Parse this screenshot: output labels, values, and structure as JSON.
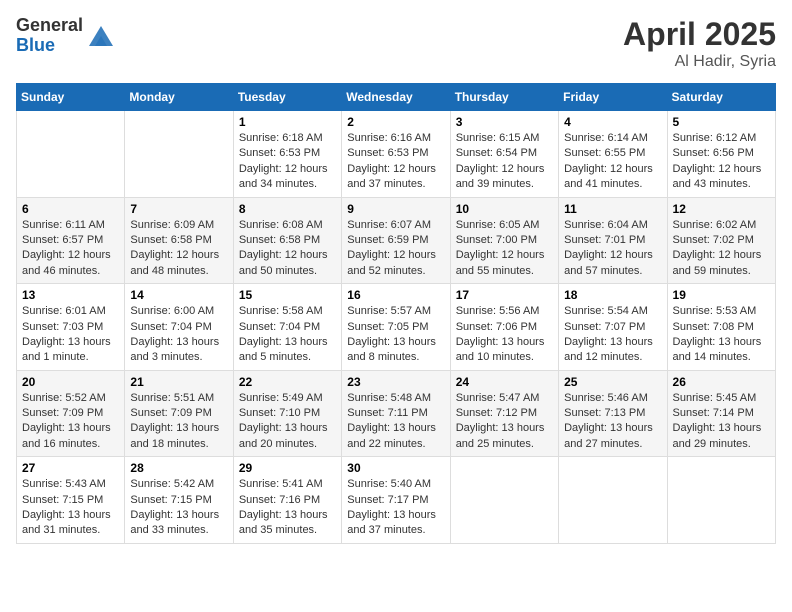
{
  "header": {
    "logo_general": "General",
    "logo_blue": "Blue",
    "month_year": "April 2025",
    "location": "Al Hadir, Syria"
  },
  "weekdays": [
    "Sunday",
    "Monday",
    "Tuesday",
    "Wednesday",
    "Thursday",
    "Friday",
    "Saturday"
  ],
  "weeks": [
    [
      {
        "day": "",
        "content": ""
      },
      {
        "day": "",
        "content": ""
      },
      {
        "day": "1",
        "content": "Sunrise: 6:18 AM\nSunset: 6:53 PM\nDaylight: 12 hours and 34 minutes."
      },
      {
        "day": "2",
        "content": "Sunrise: 6:16 AM\nSunset: 6:53 PM\nDaylight: 12 hours and 37 minutes."
      },
      {
        "day": "3",
        "content": "Sunrise: 6:15 AM\nSunset: 6:54 PM\nDaylight: 12 hours and 39 minutes."
      },
      {
        "day": "4",
        "content": "Sunrise: 6:14 AM\nSunset: 6:55 PM\nDaylight: 12 hours and 41 minutes."
      },
      {
        "day": "5",
        "content": "Sunrise: 6:12 AM\nSunset: 6:56 PM\nDaylight: 12 hours and 43 minutes."
      }
    ],
    [
      {
        "day": "6",
        "content": "Sunrise: 6:11 AM\nSunset: 6:57 PM\nDaylight: 12 hours and 46 minutes."
      },
      {
        "day": "7",
        "content": "Sunrise: 6:09 AM\nSunset: 6:58 PM\nDaylight: 12 hours and 48 minutes."
      },
      {
        "day": "8",
        "content": "Sunrise: 6:08 AM\nSunset: 6:58 PM\nDaylight: 12 hours and 50 minutes."
      },
      {
        "day": "9",
        "content": "Sunrise: 6:07 AM\nSunset: 6:59 PM\nDaylight: 12 hours and 52 minutes."
      },
      {
        "day": "10",
        "content": "Sunrise: 6:05 AM\nSunset: 7:00 PM\nDaylight: 12 hours and 55 minutes."
      },
      {
        "day": "11",
        "content": "Sunrise: 6:04 AM\nSunset: 7:01 PM\nDaylight: 12 hours and 57 minutes."
      },
      {
        "day": "12",
        "content": "Sunrise: 6:02 AM\nSunset: 7:02 PM\nDaylight: 12 hours and 59 minutes."
      }
    ],
    [
      {
        "day": "13",
        "content": "Sunrise: 6:01 AM\nSunset: 7:03 PM\nDaylight: 13 hours and 1 minute."
      },
      {
        "day": "14",
        "content": "Sunrise: 6:00 AM\nSunset: 7:04 PM\nDaylight: 13 hours and 3 minutes."
      },
      {
        "day": "15",
        "content": "Sunrise: 5:58 AM\nSunset: 7:04 PM\nDaylight: 13 hours and 5 minutes."
      },
      {
        "day": "16",
        "content": "Sunrise: 5:57 AM\nSunset: 7:05 PM\nDaylight: 13 hours and 8 minutes."
      },
      {
        "day": "17",
        "content": "Sunrise: 5:56 AM\nSunset: 7:06 PM\nDaylight: 13 hours and 10 minutes."
      },
      {
        "day": "18",
        "content": "Sunrise: 5:54 AM\nSunset: 7:07 PM\nDaylight: 13 hours and 12 minutes."
      },
      {
        "day": "19",
        "content": "Sunrise: 5:53 AM\nSunset: 7:08 PM\nDaylight: 13 hours and 14 minutes."
      }
    ],
    [
      {
        "day": "20",
        "content": "Sunrise: 5:52 AM\nSunset: 7:09 PM\nDaylight: 13 hours and 16 minutes."
      },
      {
        "day": "21",
        "content": "Sunrise: 5:51 AM\nSunset: 7:09 PM\nDaylight: 13 hours and 18 minutes."
      },
      {
        "day": "22",
        "content": "Sunrise: 5:49 AM\nSunset: 7:10 PM\nDaylight: 13 hours and 20 minutes."
      },
      {
        "day": "23",
        "content": "Sunrise: 5:48 AM\nSunset: 7:11 PM\nDaylight: 13 hours and 22 minutes."
      },
      {
        "day": "24",
        "content": "Sunrise: 5:47 AM\nSunset: 7:12 PM\nDaylight: 13 hours and 25 minutes."
      },
      {
        "day": "25",
        "content": "Sunrise: 5:46 AM\nSunset: 7:13 PM\nDaylight: 13 hours and 27 minutes."
      },
      {
        "day": "26",
        "content": "Sunrise: 5:45 AM\nSunset: 7:14 PM\nDaylight: 13 hours and 29 minutes."
      }
    ],
    [
      {
        "day": "27",
        "content": "Sunrise: 5:43 AM\nSunset: 7:15 PM\nDaylight: 13 hours and 31 minutes."
      },
      {
        "day": "28",
        "content": "Sunrise: 5:42 AM\nSunset: 7:15 PM\nDaylight: 13 hours and 33 minutes."
      },
      {
        "day": "29",
        "content": "Sunrise: 5:41 AM\nSunset: 7:16 PM\nDaylight: 13 hours and 35 minutes."
      },
      {
        "day": "30",
        "content": "Sunrise: 5:40 AM\nSunset: 7:17 PM\nDaylight: 13 hours and 37 minutes."
      },
      {
        "day": "",
        "content": ""
      },
      {
        "day": "",
        "content": ""
      },
      {
        "day": "",
        "content": ""
      }
    ]
  ]
}
